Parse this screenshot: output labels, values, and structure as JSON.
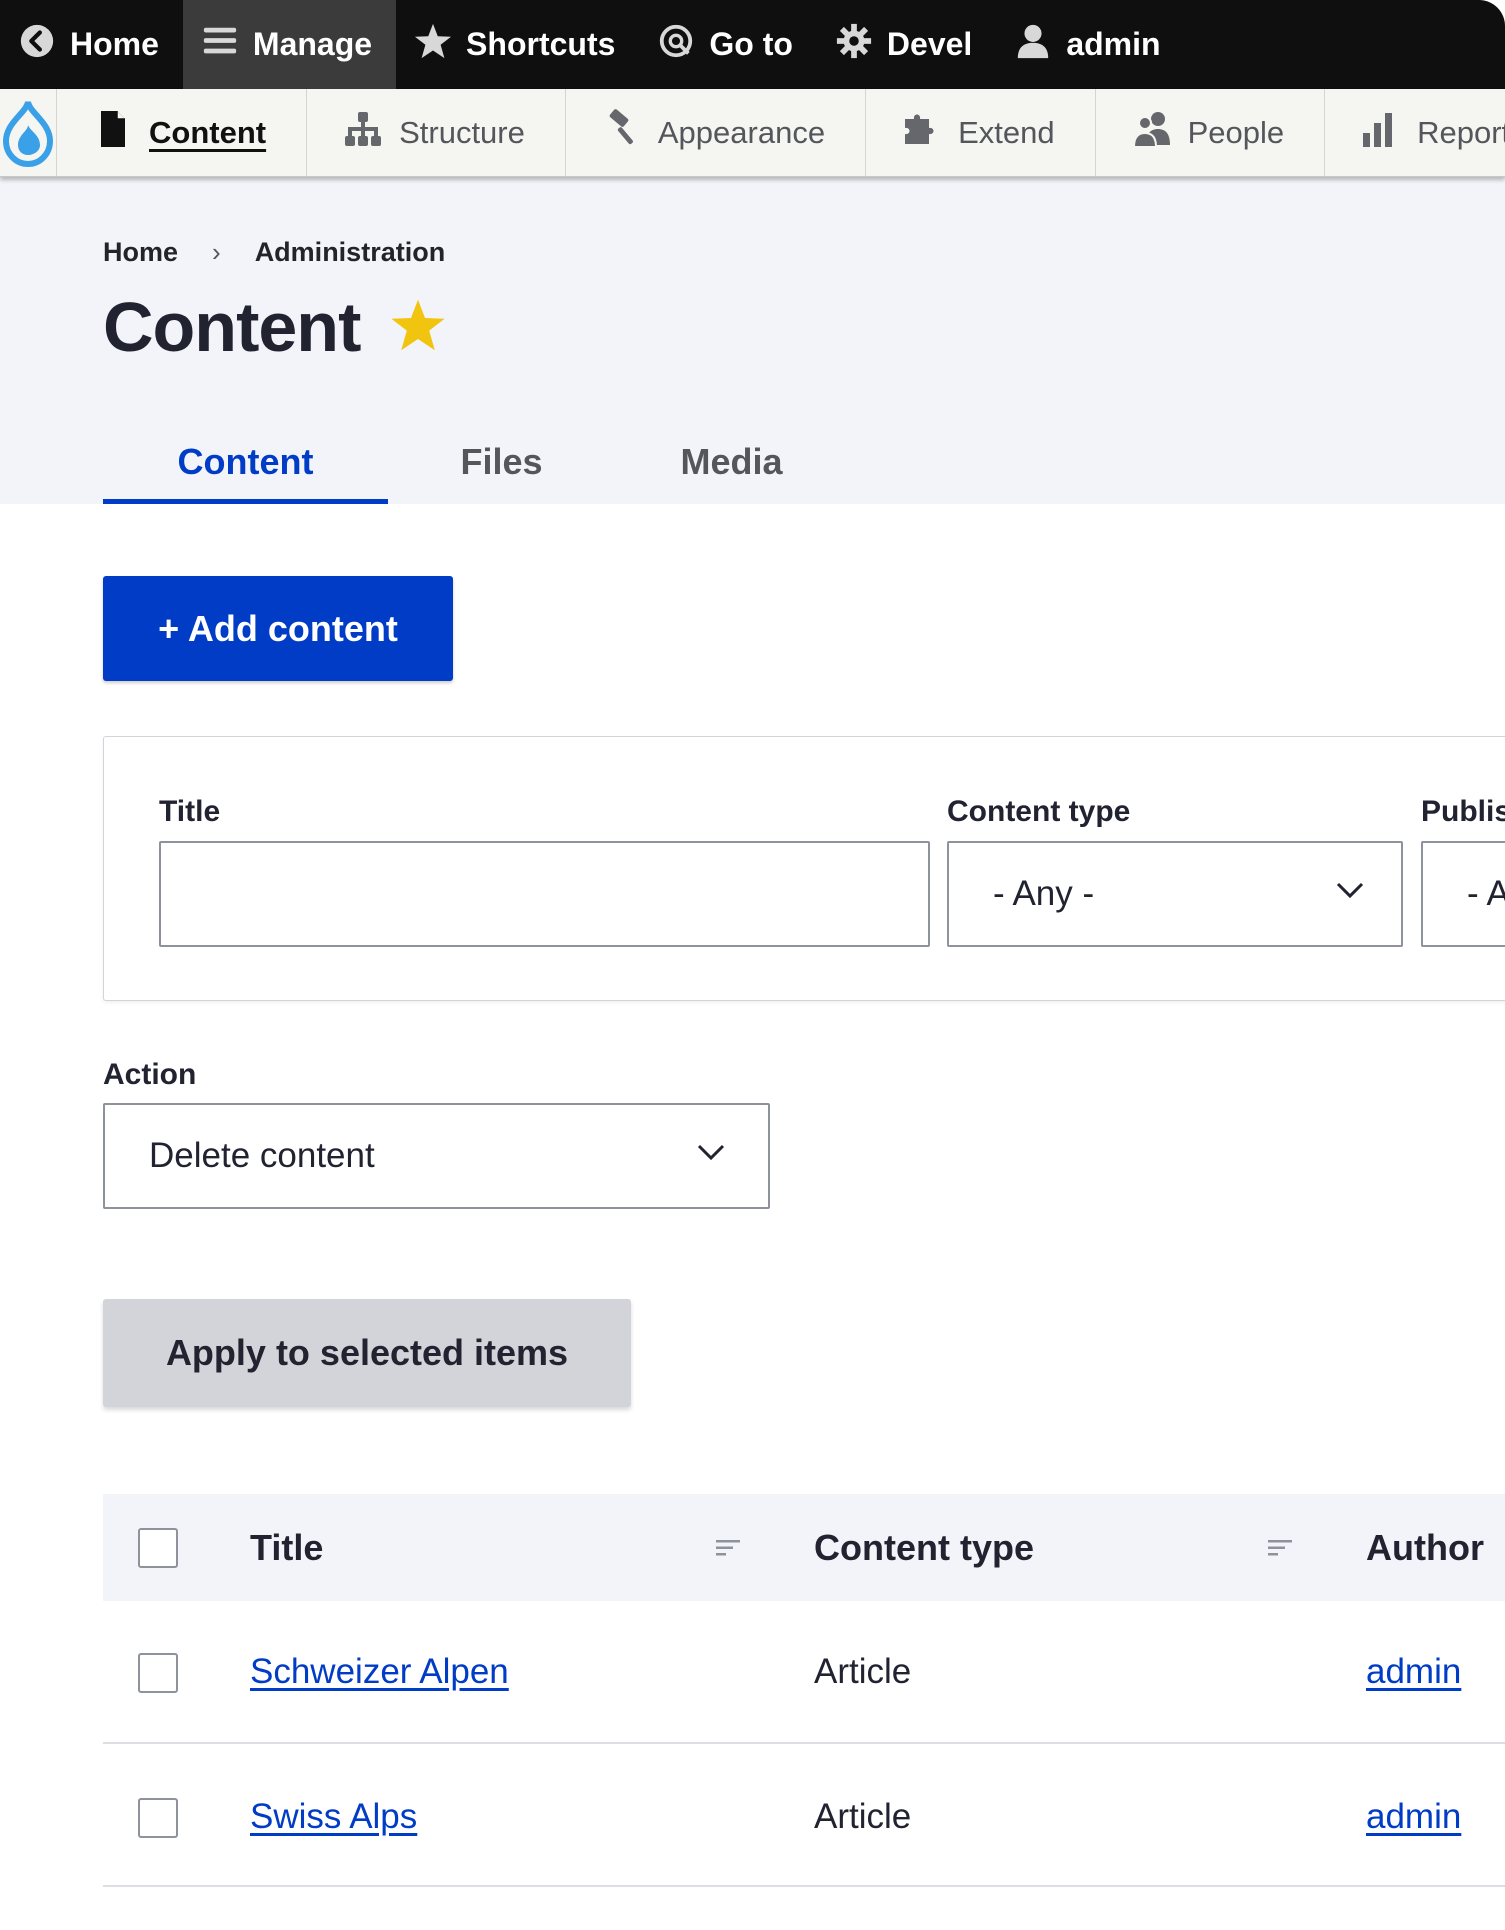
{
  "toolbar": {
    "items": [
      {
        "label": "Home",
        "icon": "back-circle-icon"
      },
      {
        "label": "Manage",
        "icon": "hamburger-menu-icon"
      },
      {
        "label": "Shortcuts",
        "icon": "star-icon"
      },
      {
        "label": "Go to",
        "icon": "search-icon"
      },
      {
        "label": "Devel",
        "icon": "gear-icon"
      },
      {
        "label": "admin",
        "icon": "user-icon"
      }
    ]
  },
  "tray": {
    "logo": "drupal-logo-icon",
    "items": [
      {
        "label": "Content",
        "icon": "document-icon"
      },
      {
        "label": "Structure",
        "icon": "sitemap-icon"
      },
      {
        "label": "Appearance",
        "icon": "paint-roller-icon"
      },
      {
        "label": "Extend",
        "icon": "puzzle-icon"
      },
      {
        "label": "People",
        "icon": "people-icon"
      },
      {
        "label": "Reports",
        "icon": "bar-chart-icon"
      }
    ]
  },
  "breadcrumb": {
    "items": [
      "Home",
      "Administration"
    ],
    "separator": "›"
  },
  "page": {
    "title": "Content",
    "shortcut_icon": "star-icon"
  },
  "tabs": [
    {
      "label": "Content",
      "active": true
    },
    {
      "label": "Files",
      "active": false
    },
    {
      "label": "Media",
      "active": false
    }
  ],
  "add_button": "+ Add content",
  "filters": {
    "title_label": "Title",
    "title_value": "",
    "content_type_label": "Content type",
    "content_type_value": "- Any -",
    "published_label": "Publis",
    "published_value": "- A"
  },
  "action": {
    "label": "Action",
    "value": "Delete content"
  },
  "apply_button": "Apply to selected items",
  "table": {
    "headers": [
      "Title",
      "Content type",
      "Author"
    ],
    "rows": [
      {
        "title": "Schweizer Alpen",
        "type": "Article",
        "author": "admin"
      },
      {
        "title": "Swiss Alps",
        "type": "Article",
        "author": "admin"
      }
    ]
  },
  "colors": {
    "primary": "#003cc5",
    "toolbar_bg": "#0f0f0f",
    "header_bg": "#f3f4f9",
    "star": "#f1c40f"
  }
}
